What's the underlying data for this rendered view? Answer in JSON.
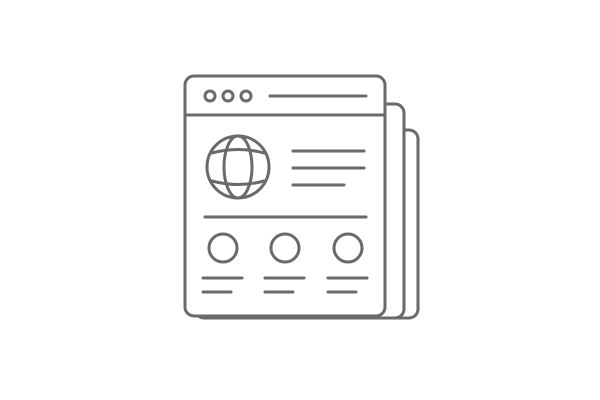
{
  "illustration": {
    "subject": "web page icon",
    "icons": [
      "browser-window-icon",
      "stacked-pages-icon",
      "window-control-dot-icon",
      "address-bar-icon",
      "globe-icon",
      "text-line-icon",
      "divider-icon",
      "feature-circle-icon"
    ]
  },
  "colors": {
    "background": "#ffffff",
    "stroke": "#6a6a6a"
  }
}
